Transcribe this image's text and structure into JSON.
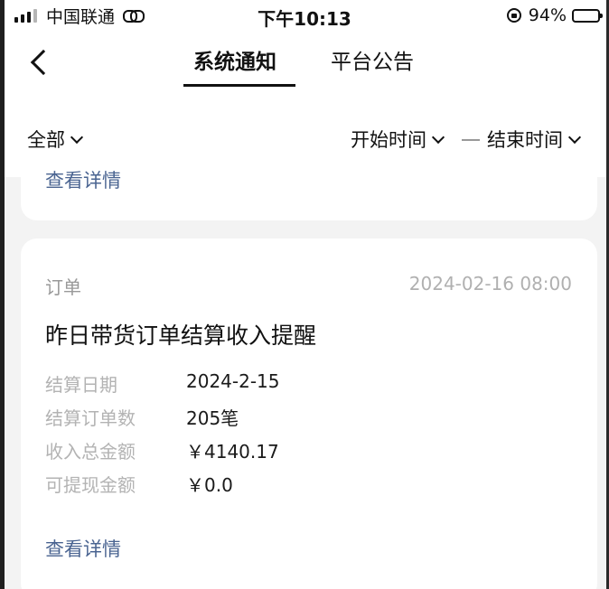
{
  "status_bar": {
    "carrier": "中国联通",
    "time": "下午10:13",
    "battery_percent": "94%",
    "battery_level": 0.94,
    "signal_icon": "signal-bars-icon",
    "link_icon": "link-icon",
    "orientation_lock_icon": "orientation-lock-icon"
  },
  "nav": {
    "back_icon": "chevron-left-icon",
    "tabs": [
      {
        "label": "系统通知",
        "active": true
      },
      {
        "label": "平台公告",
        "active": false
      }
    ]
  },
  "filters": {
    "category": "全部",
    "start_time": "开始时间",
    "end_time": "结束时间"
  },
  "previous_card": {
    "detail_link": "查看详情"
  },
  "notice": {
    "category": "订单",
    "date": "2024-02-16 08:00",
    "title": "昨日带货订单结算收入提醒",
    "rows": [
      {
        "label": "结算日期",
        "value": "2024-2-15"
      },
      {
        "label": "结算订单数",
        "value": "205笔"
      },
      {
        "label": "收入总金额",
        "value": "￥4140.17"
      },
      {
        "label": "可提现金额",
        "value": "￥0.0"
      }
    ],
    "detail_link": "查看详情"
  },
  "colors": {
    "link": "#4a6491",
    "label": "#b3b3b3",
    "background": "#f3f3f3"
  }
}
